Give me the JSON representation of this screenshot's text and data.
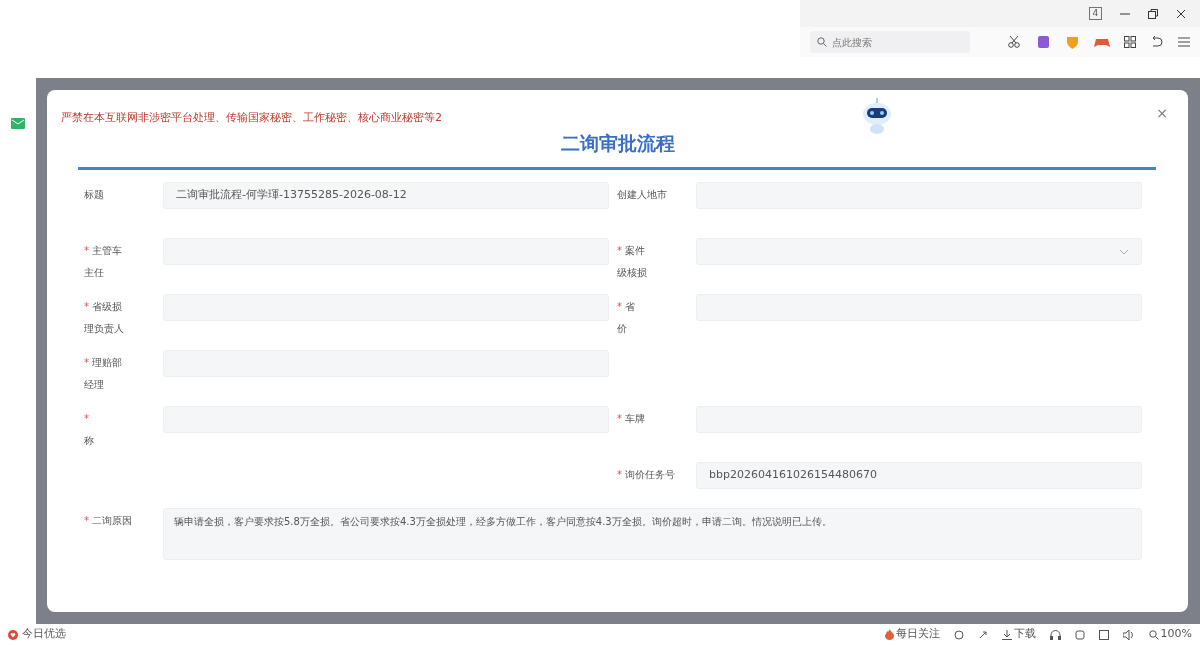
{
  "browser": {
    "tab_count": "4",
    "search": {
      "placeholder": "点此搜索"
    }
  },
  "notice": "严禁在本互联网非涉密平台处理、传输国家秘密、工作秘密、核心商业秘密等2",
  "dialog": {
    "title": "二询审批流程",
    "close": "×",
    "rows": [
      {
        "left": {
          "label": [
            "标题"
          ],
          "kind": "text",
          "value": "二询审批流程-何学琿-13755285-2026-08-12"
        },
        "right": {
          "label": [
            "创建人地市"
          ],
          "kind": "text"
        }
      },
      {
        "left": {
          "label": [
            "主管车",
            "主任"
          ],
          "mark": "*",
          "kind": "text"
        },
        "right": {
          "label": [
            "案件",
            "级核损"
          ],
          "mark": "*",
          "kind": "select"
        }
      },
      {
        "left": {
          "label": [
            "省级损",
            "理负责人"
          ],
          "mark": "*",
          "kind": "text"
        },
        "right": {
          "label": [
            "省",
            "价"
          ],
          "mark": "*",
          "kind": "text"
        }
      },
      {
        "left": {
          "label": [
            "理赔部",
            "经理"
          ],
          "mark": "*",
          "kind": "text"
        }
      },
      {
        "left": {
          "label": [
            "称"
          ],
          "mark": "*",
          "mark_alone": true,
          "kind": "text"
        },
        "right": {
          "label": [
            "车牌"
          ],
          "mark": "*",
          "kind": "text"
        }
      },
      {
        "right": {
          "label": [
            "询价任务号"
          ],
          "mark": "*",
          "kind": "text",
          "value": "bbp202604161026154480670"
        }
      },
      {
        "full": {
          "label": [
            "二询原因"
          ],
          "mark": "*",
          "kind": "textarea",
          "value": "辆申请全损，客户要求按5.8万全损。省公司要求按4.3万全损处理，经多方做工作，客户同意按4.3万全损。询价超时，申请二询。情况说明已上传。"
        }
      }
    ]
  },
  "status_bar": {
    "left": "今日优选",
    "follow": "每日关注",
    "download": "下载",
    "zoom": "100%"
  }
}
